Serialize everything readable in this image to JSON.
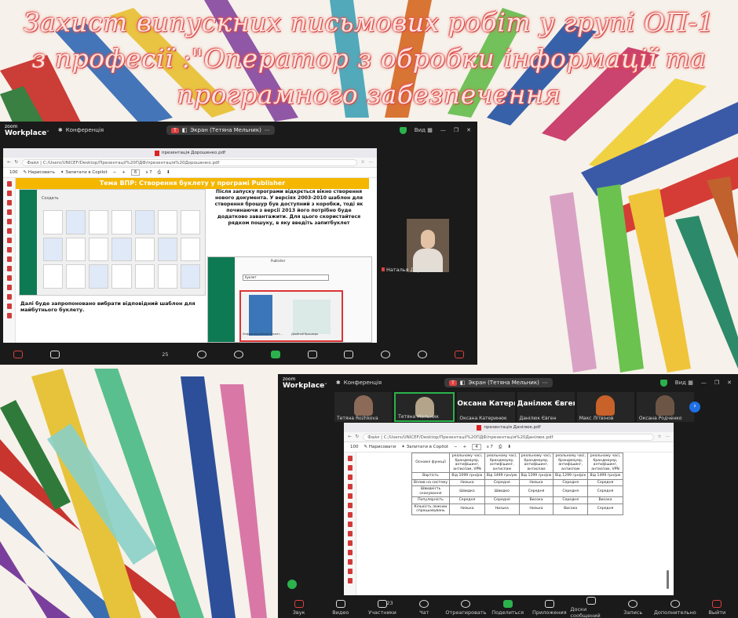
{
  "title": {
    "line1": "Захист випускних письмових робіт у групі ОП-1",
    "line2": "з професії :\"Оператор з обробки інформації та",
    "line3": "програмного забезпечення"
  },
  "zoom1": {
    "logo_top": "zoom",
    "logo_bottom": "Workplace",
    "conference": "Конференція",
    "screen_label": "Экран (Тетяна Мельник)",
    "view": "Вид",
    "browser": {
      "tab": "презентація Дорошенко.pdf",
      "url": "Файл | C:/Users/UNICEF/Desktop/Презентації%20ПДФ/презентація%20Дорошенко.pdf",
      "draw": "Нарисовать",
      "ask": "Запитати в Copilot",
      "page": "6",
      "page_total": "з 7",
      "zoom": "100"
    },
    "slide": {
      "heading": "Тема ВПР: Створення буклету у програмі Publisher",
      "para1": "Після запуску програми відкрється вікно створення нового документа. У версіях 2003-2010 шаблон для створення брошур був доступний з коробки, тоді як починаючи з версії 2013 його потрібно буде додатково завантажити. Для цього скористайтеся рядком пошуку, в яку введіть запитбуклет",
      "para2": "Далі буде запропоновано вибрати відповідний шаблон для майбутнього буклету.",
      "pub_create": "Создать",
      "pub_search": "буклет",
      "pub_title": "Publisher",
      "pub_t1": "Информационный буклет...",
      "pub_t2": "Двойной брошюра"
    },
    "participant": "Наталья Дорошенко",
    "toolbar": {
      "participants_count": "25"
    }
  },
  "zoom2": {
    "logo_top": "zoom",
    "logo_bottom": "Workplace",
    "conference": "Конференція",
    "screen_label": "Экран (Тетяна Мельник)",
    "view": "Вид",
    "participants": [
      {
        "name": "Тетяна Rozhkova",
        "big": ""
      },
      {
        "name": "Тетяна Мельник",
        "big": ""
      },
      {
        "name": "Оксана Катеринюк",
        "big": "Оксана Катери..."
      },
      {
        "name": "Данілюк Євген",
        "big": "Данілюк Євген"
      },
      {
        "name": "Макс Літвінов",
        "big": ""
      },
      {
        "name": "Оксана Родченко",
        "big": ""
      }
    ],
    "browser": {
      "tab": "презентація Данілюк.pdf",
      "url": "Файл | C:/Users/UNICEF/Desktop/Презентації%20ПДФ/презентація%20Данілюк.pdf",
      "draw": "Нарисовати",
      "ask": "Запитати в Copilot",
      "page": "4",
      "page_total": "з 7",
      "zoom": "100"
    },
    "table": {
      "rows": [
        [
          "Основні функції",
          "реальному часі, брандмауер, антифішинг, антиспам, VPN",
          "реальному часі, брандмауер, антифішинг, антиспам",
          "реальному часі, брандмауер, антифішинг, антиспам",
          "реальному часі, брандмауер, антифішинг, антиспам",
          "реальному часі, брандмауер, антифішинг, антиспам, VPN"
        ],
        [
          "Вартість",
          "Від 1099 грн/рік",
          "Від 1499 грн/рік",
          "Від 1299 грн/рік",
          "Від 1299 грн/рік",
          "Від 1499 грн/рік"
        ],
        [
          "Вплив на систему",
          "Низька",
          "Середня",
          "Низька",
          "Середня",
          "Середня"
        ],
        [
          "Швидкість сканування",
          "Швидко",
          "Швидко",
          "Середня",
          "Середня",
          "Середня"
        ],
        [
          "Популярність",
          "Середня",
          "Середня",
          "Висока",
          "Середня",
          "Висока"
        ],
        [
          "Кількість ложних спрацьовувань",
          "Низька",
          "Низька",
          "Низька",
          "Висока",
          "Середня"
        ]
      ]
    },
    "toolbar": {
      "participants_count": "23",
      "items": [
        "Звук",
        "Видео",
        "Участники",
        "Чат",
        "Отреагировать",
        "Поделиться",
        "Приложения",
        "Доски сообщений",
        "Запись",
        "Дополнительно",
        "Выйти"
      ]
    }
  },
  "colors": {
    "accent_title": "#e1534f",
    "zoom_green": "#2bb24c",
    "slide_bar": "#f5b600"
  }
}
